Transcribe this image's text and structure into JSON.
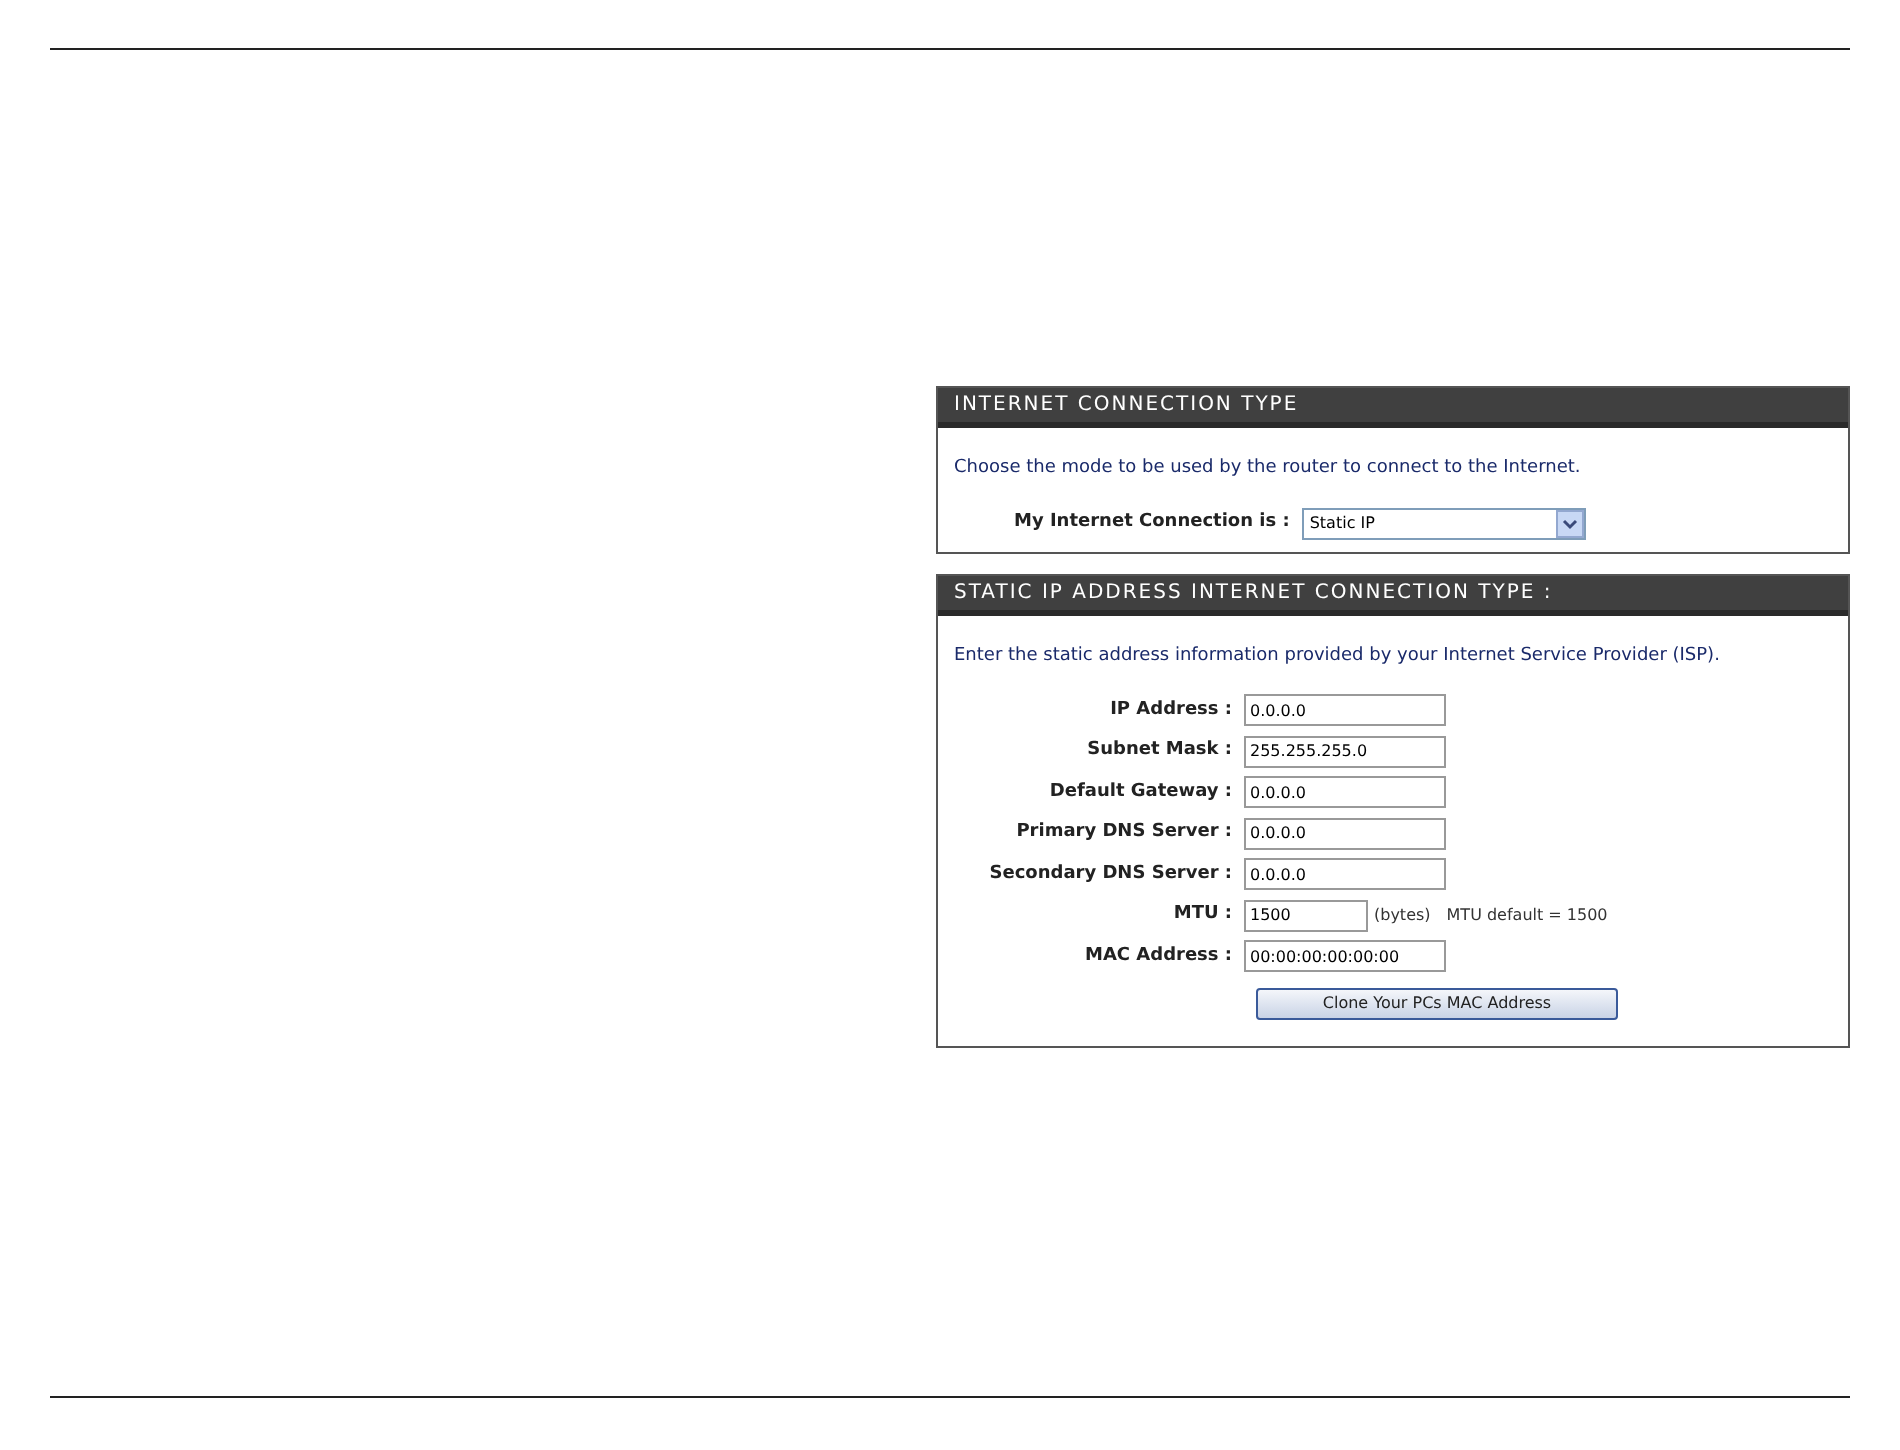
{
  "connection_type": {
    "title": "INTERNET CONNECTION TYPE",
    "intro": "Choose the mode to be used by the router to connect to the Internet.",
    "label": "My Internet Connection is :",
    "value": "Static IP"
  },
  "static_ip": {
    "title": "STATIC IP ADDRESS INTERNET CONNECTION TYPE :",
    "intro": "Enter the static address information provided by your Internet Service Provider (ISP).",
    "fields": [
      {
        "kind": "full",
        "label": "IP Address :",
        "value": "0.0.0.0"
      },
      {
        "kind": "full",
        "label": "Subnet Mask :",
        "value": "255.255.255.0"
      },
      {
        "kind": "full",
        "label": "Default Gateway :",
        "value": "0.0.0.0"
      },
      {
        "kind": "full",
        "label": "Primary DNS Server :",
        "value": "0.0.0.0"
      },
      {
        "kind": "full",
        "label": "Secondary DNS Server :",
        "value": "0.0.0.0"
      },
      {
        "kind": "short",
        "label": "MTU :",
        "value": "1500",
        "unit": "(bytes)",
        "note": "MTU default = 1500"
      },
      {
        "kind": "full",
        "label": "MAC Address :",
        "value": "00:00:00:00:00:00"
      }
    ],
    "clone_button": "Clone Your PCs MAC Address"
  }
}
